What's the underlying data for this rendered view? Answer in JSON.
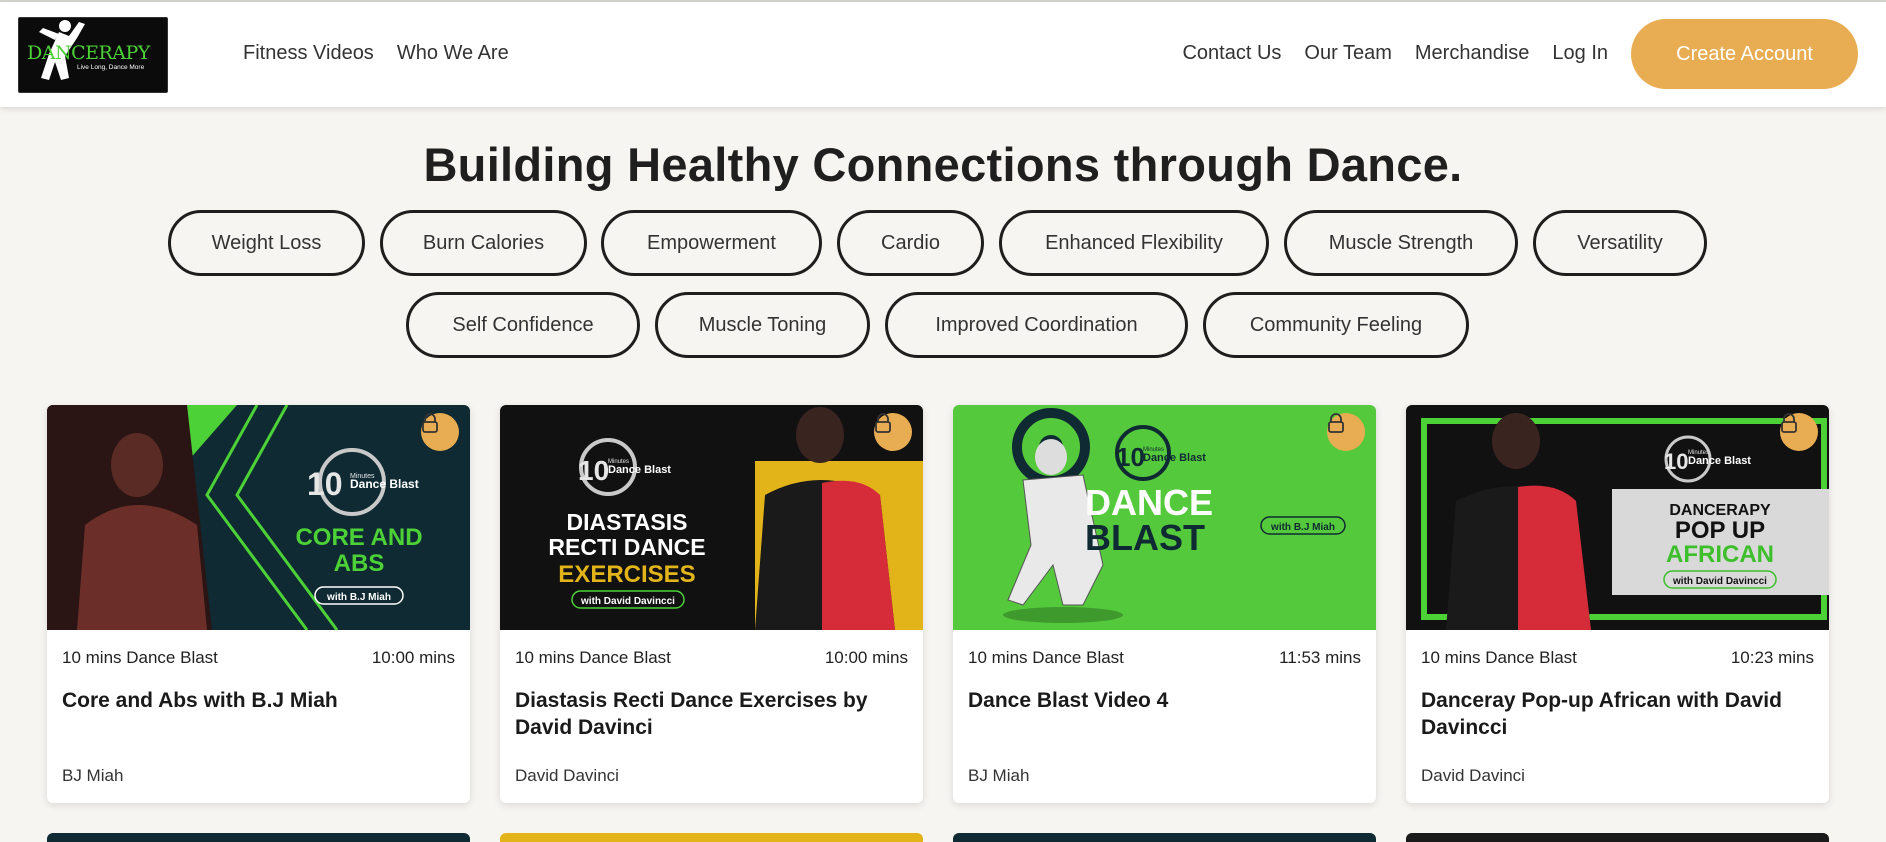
{
  "header": {
    "logo": {
      "word": "DANCERAPY",
      "tagline": "Live Long, Dance More"
    },
    "nav_left": [
      "Fitness Videos",
      "Who We Are"
    ],
    "nav_right": [
      "Contact Us",
      "Our Team",
      "Merchandise",
      "Log In"
    ],
    "cta_label": "Create Account"
  },
  "hero": {
    "headline": "Building Healthy Connections through Dance.",
    "tags": [
      "Weight Loss",
      "Burn Calories",
      "Empowerment",
      "Cardio",
      "Enhanced Flexibility",
      "Muscle Strength",
      "Versatility",
      "Self Confidence",
      "Muscle Toning",
      "Improved Coordination",
      "Community Feeling"
    ]
  },
  "videos": [
    {
      "category": "10 mins Dance Blast",
      "duration": "10:00 mins",
      "title": "Core and Abs with B.J Miah",
      "author": "BJ Miah",
      "thumb_text": {
        "num": "10",
        "line1": "CORE AND",
        "line2": "ABS",
        "tag": "with B.J Miah",
        "small": "Dance Blast",
        "tiny": "Minutes"
      },
      "locked": true
    },
    {
      "category": "10 mins Dance Blast",
      "duration": "10:00 mins",
      "title": "Diastasis Recti Dance Exercises by David Davinci",
      "author": "David Davinci",
      "thumb_text": {
        "num": "10",
        "line1": "DIASTASIS",
        "line2": "RECTI DANCE",
        "line3": "EXERCISES",
        "tag": "with David Davincci",
        "small": "Dance Blast",
        "tiny": "Minutes"
      },
      "locked": true
    },
    {
      "category": "10 mins Dance Blast",
      "duration": "11:53 mins",
      "title": "Dance Blast Video 4",
      "author": "BJ Miah",
      "thumb_text": {
        "num": "10",
        "line1": "DANCE",
        "line2": "BLAST",
        "tag": "with B.J Miah",
        "small": "Dance Blast",
        "tiny": "Minutes"
      },
      "locked": true
    },
    {
      "category": "10 mins Dance Blast",
      "duration": "10:23 mins",
      "title": "Danceray Pop-up African with David Davincci",
      "author": "David Davinci",
      "thumb_text": {
        "num": "10",
        "line1": "DANCERAPY",
        "line2": "POP UP",
        "line3": "AFRICAN",
        "tag": "with David Davincci",
        "small": "Dance Blast",
        "tiny": "Minutes"
      },
      "locked": true
    }
  ],
  "colors": {
    "accent": "#e8ad52",
    "brand_green": "#4cd137",
    "text": "#1e1e1e",
    "background": "#f7f5f2"
  },
  "icons": {
    "lock": "lock-icon"
  }
}
